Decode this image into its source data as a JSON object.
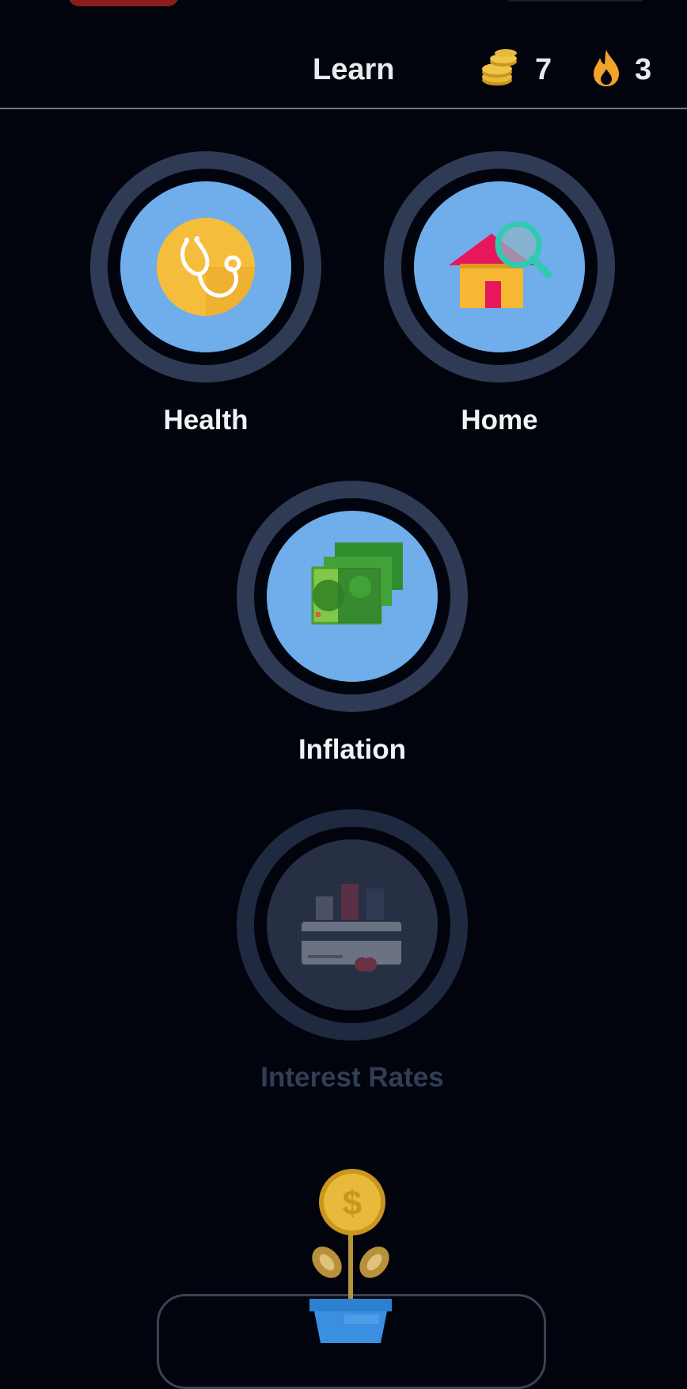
{
  "header": {
    "title": "Learn",
    "coins": {
      "icon": "coins-icon",
      "value": "7"
    },
    "streak": {
      "icon": "flame-icon",
      "value": "3"
    }
  },
  "lessons": [
    {
      "label": "Health",
      "icon": "stethoscope-icon",
      "locked": false
    },
    {
      "label": "Home",
      "icon": "house-search-icon",
      "locked": false
    },
    {
      "label": "Inflation",
      "icon": "money-stack-icon",
      "locked": false
    },
    {
      "label": "Interest Rates",
      "icon": "credit-card-chart-icon",
      "locked": true
    }
  ],
  "footer": {
    "icon": "money-plant-icon"
  },
  "colors": {
    "background": "#02040d",
    "ring": "#2f3b54",
    "disc": "#6fadeb",
    "coin_gold": "#e8b93a",
    "flame": "#f0a22a",
    "locked_text": "#333d55"
  }
}
